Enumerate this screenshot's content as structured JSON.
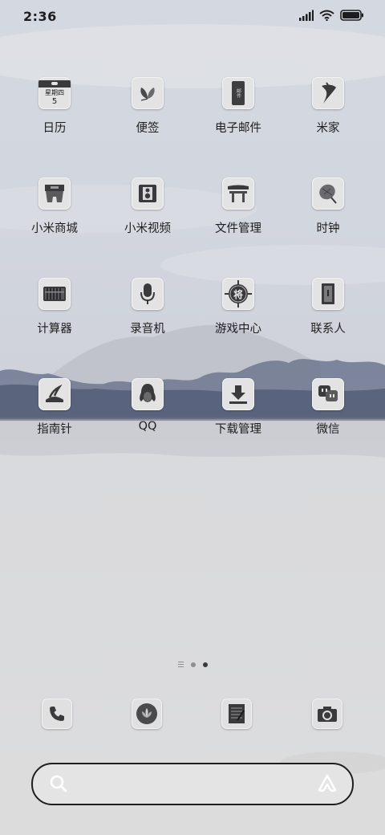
{
  "status": {
    "time": "2:36"
  },
  "apps": [
    {
      "label": "日历",
      "icon": "calendar-icon",
      "calendar_weekday": "星期四",
      "calendar_day": "5"
    },
    {
      "label": "便签",
      "icon": "notes-leaf-icon"
    },
    {
      "label": "电子邮件",
      "icon": "email-icon",
      "email_glyph": "邮件"
    },
    {
      "label": "米家",
      "icon": "mijia-icon"
    },
    {
      "label": "小米商城",
      "icon": "mall-icon"
    },
    {
      "label": "小米视频",
      "icon": "video-icon"
    },
    {
      "label": "文件管理",
      "icon": "file-manager-icon"
    },
    {
      "label": "时钟",
      "icon": "clock-icon"
    },
    {
      "label": "计算器",
      "icon": "abacus-icon"
    },
    {
      "label": "录音机",
      "icon": "microphone-icon"
    },
    {
      "label": "游戏中心",
      "icon": "game-center-icon",
      "game_glyph": "将"
    },
    {
      "label": "联系人",
      "icon": "contacts-icon"
    },
    {
      "label": "指南针",
      "icon": "compass-icon"
    },
    {
      "label": "QQ",
      "icon": "qq-penguin-icon"
    },
    {
      "label": "下载管理",
      "icon": "download-icon"
    },
    {
      "label": "微信",
      "icon": "wechat-icon"
    }
  ],
  "dock": [
    {
      "icon": "phone-icon"
    },
    {
      "icon": "lotus-icon"
    },
    {
      "icon": "notebook-icon"
    },
    {
      "icon": "camera-icon"
    }
  ],
  "search": {
    "placeholder": ""
  },
  "colors": {
    "background": "#dcdcdd",
    "mountains": "#6f7890",
    "text": "#1e1e1e"
  }
}
